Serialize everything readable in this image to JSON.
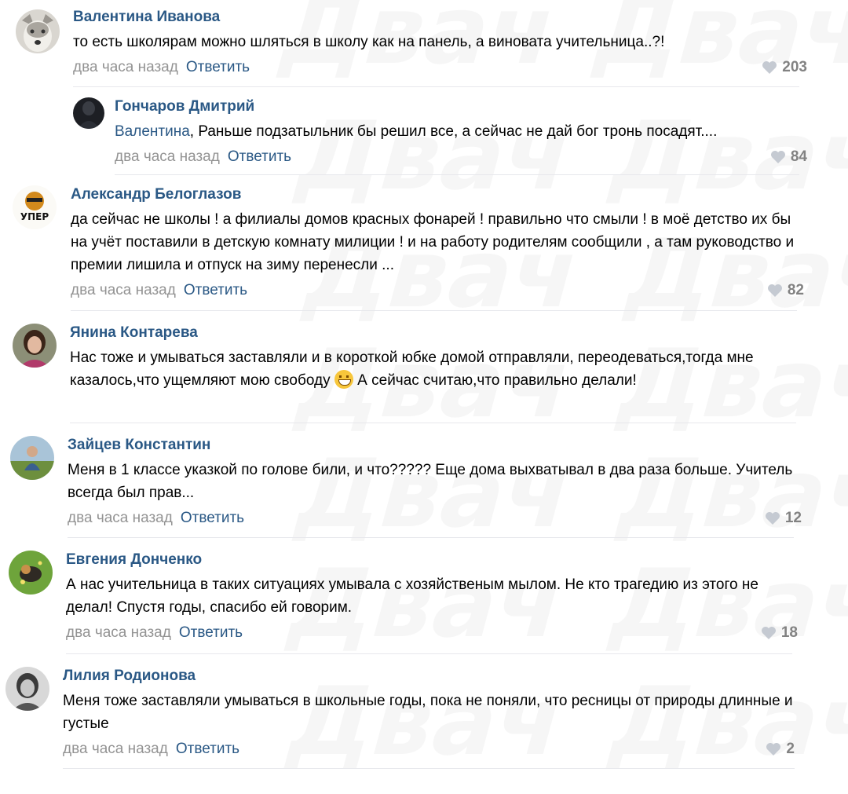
{
  "watermark": "Двач",
  "icons": {
    "like": "heart-icon",
    "emoji": "grinning-face-emoji"
  },
  "colors": {
    "author": "#2a5885",
    "meta": "#939393",
    "like": "#828282"
  },
  "comments": [
    {
      "author": "Валентина Иванова",
      "text": "то есть школярам можно шляться в школу как на панель, а виновата учительница..?!",
      "time": "два часа назад",
      "reply": "Ответить",
      "likes": "203"
    },
    {
      "author": "Гончаров Дмитрий",
      "mention": "Валентина",
      "text": ", Раньше подзатыльник бы решил все, а сейчас не дай бог тронь посадят....",
      "time": "два часа назад",
      "reply": "Ответить",
      "likes": "84"
    },
    {
      "author": "Александр Белоглазов",
      "avatar_text": "УПЕР",
      "text": "да сейчас не школы ! а филиалы домов красных фонарей ! правильно что смыли ! в моё детство их бы на учёт поставили в детскую комнату милиции ! и на работу родителям сообщили , а там руководство и премии лишила и отпуск на зиму перенесли ...",
      "time": "два часа назад",
      "reply": "Ответить",
      "likes": "82"
    },
    {
      "author": "Янина Контарева",
      "text_before": "Нас тоже и умываться заставляли и в короткой юбке домой отправляли, переодеваться,тогда мне казалось,что ущемляют мою свободу",
      "text_after": "А сейчас считаю,что правильно делали!"
    },
    {
      "author": "Зайцев Константин",
      "text": "Меня в 1 классе указкой по голове били, и что????? Еще дома выхватывал в два раза больше. Учитель всегда был прав...",
      "time": "два часа назад",
      "reply": "Ответить",
      "likes": "12"
    },
    {
      "author": "Евгения Донченко",
      "text": "А нас учительница в таких ситуациях умывала с хозяйственым мылом. Не кто трагедию из этого не делал! Спустя годы, спасибо ей говорим.",
      "time": "два часа назад",
      "reply": "Ответить",
      "likes": "18"
    },
    {
      "author": "Лилия Родионова",
      "text": "Меня тоже заставляли умываться в школьные годы, пока не поняли, что ресницы от природы длинные и густые",
      "time": "два часа назад",
      "reply": "Ответить",
      "likes": "2"
    }
  ]
}
